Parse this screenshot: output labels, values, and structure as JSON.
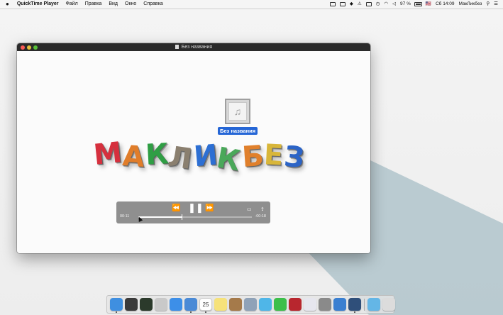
{
  "menubar": {
    "apple": "",
    "app_name": "QuickTime Player",
    "menus": [
      "Файл",
      "Правка",
      "Вид",
      "Окно",
      "Справка"
    ],
    "battery": "97 %",
    "flag": "🇺🇸",
    "clock": "Сб 14:09",
    "user": "МакЛикбез"
  },
  "window": {
    "title": "Без названия",
    "file_label": "Без названия",
    "file_icon": "music-note-icon",
    "logo_letters": [
      "М",
      "А",
      "К",
      "Л",
      "И",
      "К",
      "Б",
      "Е",
      "З"
    ],
    "logo_colors": [
      "#d6303e",
      "#e07d2a",
      "#2f9e44",
      "#8a7f6f",
      "#2d6fd3",
      "#4aa85a",
      "#e0802c",
      "#d8b63a",
      "#2c64c6"
    ]
  },
  "controller": {
    "time_elapsed": "00:11",
    "time_remaining": "-00:18",
    "progress": 0.38,
    "rewind_icon": "⏪",
    "pause_icon": "❚❚",
    "forward_icon": "⏩",
    "airplay_icon": "▭",
    "share_icon": "⇪"
  },
  "dock": {
    "apps": [
      "finder",
      "launchpad",
      "mission-control",
      "rocket",
      "safari",
      "mail",
      "calendar",
      "notes",
      "contacts",
      "photos",
      "messages",
      "facetime",
      "photo-booth",
      "itunes",
      "system-preferences",
      "app-store",
      "quicktime",
      "downloads",
      "trash"
    ],
    "calendar_date": "25"
  }
}
